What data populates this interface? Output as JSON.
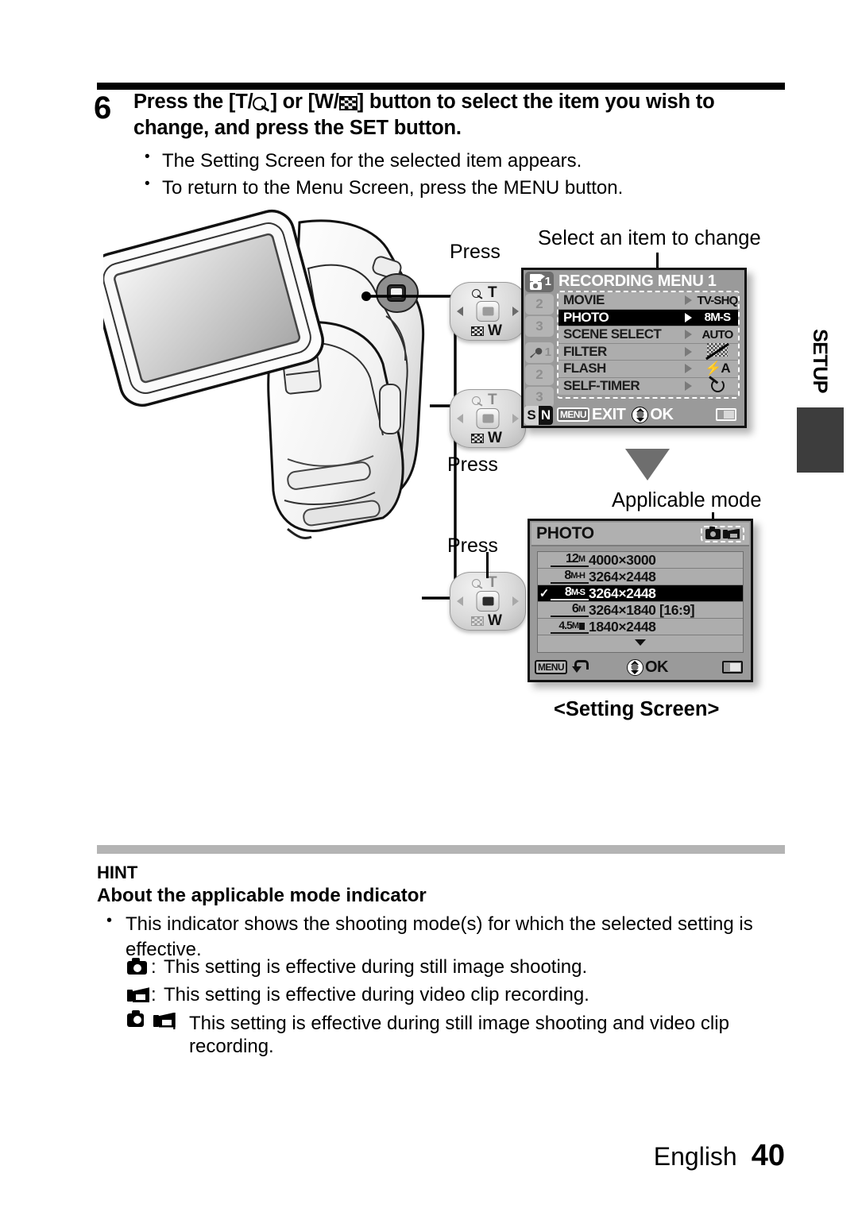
{
  "step": {
    "number": "6",
    "title_part1": "Press the [T/",
    "title_part2": "] or [W/",
    "title_part3": "] button to select the item you wish to change, and press the SET button.",
    "bullets": [
      "The Setting Screen for the selected item appears.",
      "To return to the Menu Screen, press the MENU button."
    ]
  },
  "callouts": {
    "press1": "Press",
    "press2": "Press",
    "press3": "Press",
    "select_item": "Select an item to change",
    "applicable_mode": "Applicable mode",
    "setting_screen": "<Setting Screen>"
  },
  "side_tab": {
    "label": "SETUP"
  },
  "recording_menu": {
    "title": "RECORDING MENU 1",
    "tabs": [
      {
        "name": "camera-video-tab-1",
        "number": "1",
        "active": true
      },
      {
        "name": "camera-tab-2",
        "number": "2",
        "active": false
      },
      {
        "name": "camera-tab-3",
        "number": "3",
        "active": false
      },
      {
        "name": "wrench-tab-1",
        "number": "1",
        "active": false
      },
      {
        "name": "wrench-tab-2",
        "number": "2",
        "active": false
      },
      {
        "name": "wrench-tab-3",
        "number": "3",
        "active": false
      }
    ],
    "sn_toggle": {
      "s": "S",
      "n": "N"
    },
    "items": [
      {
        "label": "MOVIE",
        "value": "TV-SHQ",
        "value_type": "text",
        "selected": false
      },
      {
        "label": "PHOTO",
        "value": "8M-S",
        "value_type": "text",
        "selected": true
      },
      {
        "label": "SCENE SELECT",
        "value": "AUTO",
        "value_type": "text",
        "selected": false
      },
      {
        "label": "FILTER",
        "value": "",
        "value_type": "filter-off-icon",
        "selected": false
      },
      {
        "label": "FLASH",
        "value": "⚡A",
        "value_type": "text",
        "selected": false
      },
      {
        "label": "SELF-TIMER",
        "value": "",
        "value_type": "self-timer-off-icon",
        "selected": false
      }
    ],
    "bottom": {
      "menu_pill": "MENU",
      "exit_label": "EXIT",
      "ok_label": "OK"
    }
  },
  "photo_screen": {
    "title": "PHOTO",
    "mode_indicator": [
      "still-camera-icon",
      "video-camera-icon"
    ],
    "rows": [
      {
        "check": "",
        "size": "12M",
        "size_main": "12",
        "size_sub": "M",
        "dimensions": "4000×3000",
        "selected": false
      },
      {
        "check": "",
        "size": "8M-H",
        "size_main": "8",
        "size_sub": "M-H",
        "dimensions": "3264×2448",
        "selected": false
      },
      {
        "check": "✓",
        "size": "8M-S",
        "size_main": "8",
        "size_sub": "M-S",
        "dimensions": "3264×2448",
        "selected": true
      },
      {
        "check": "",
        "size": "6M",
        "size_main": "6",
        "size_sub": "M",
        "dimensions": "3264×1840 [16:9]",
        "selected": false
      },
      {
        "check": "",
        "size": "4.5M",
        "size_main": "4.5",
        "size_sub": "M",
        "dimensions": "1840×2448",
        "selected": false
      }
    ],
    "bottom": {
      "menu_pill": "MENU",
      "ok_label": "OK"
    }
  },
  "hint": {
    "heading": "HINT",
    "subheading": "About the applicable mode indicator",
    "bullet": "This indicator shows the shooting mode(s) for which the selected setting is effective.",
    "lines": [
      {
        "icons": [
          "still-camera-icon"
        ],
        "colon": ":",
        "text": "This setting is effective during still image shooting."
      },
      {
        "icons": [
          "video-camera-icon"
        ],
        "colon": ":",
        "text": "This setting is effective during video clip recording."
      },
      {
        "icons": [
          "still-camera-icon",
          "video-camera-icon"
        ],
        "colon": ":",
        "text": "This setting is effective during still image shooting and video clip recording."
      }
    ]
  },
  "footer": {
    "language": "English",
    "page": "40"
  },
  "colors": {
    "lcd_background": "#9a9a9a",
    "lcd_row": "#adadad",
    "selected_row": "#000000",
    "hint_rule": "#b4b4b4",
    "setup_block": "#3d3d3d"
  }
}
